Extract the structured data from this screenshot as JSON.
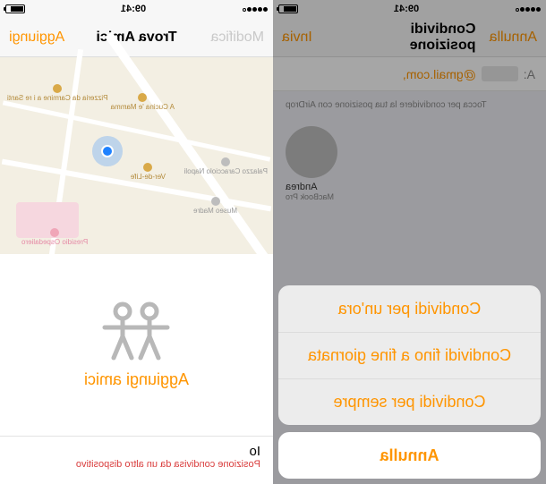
{
  "status": {
    "time": "09:41"
  },
  "right": {
    "nav": {
      "left": "Modifica",
      "title": "Trova Amici",
      "right": "Aggiungi"
    },
    "pois": {
      "pizzeria": "Pizzeria da Carmine a i re Santi",
      "cucina": "A Cucina 'e Mamma",
      "verdelife": "Ver-de-Life",
      "madre": "Museo Madre",
      "caracciolo": "Palazzo Caracciolo Napoli",
      "hospital": "Presidio Ospedaliero"
    },
    "add_friends": "Aggiungi amici",
    "me": {
      "name": "Io",
      "sub": "Posizione condivisa da un altro dispositivo"
    }
  },
  "left": {
    "nav": {
      "left": "Annulla",
      "title": "Condividi posizione",
      "right": "Invia"
    },
    "to_label": "A:",
    "to_suffix": "@gmail.com,",
    "airdrop_hint": "Tocca per condividere la tua posizione con AirDrop",
    "contact": {
      "name": "Andrea",
      "device": "MacBook Pro"
    },
    "sheet": {
      "hour": "Condividi per un'ora",
      "day": "Condividi fino a fine giornata",
      "forever": "Condividi per sempre",
      "cancel": "Annulla"
    }
  }
}
